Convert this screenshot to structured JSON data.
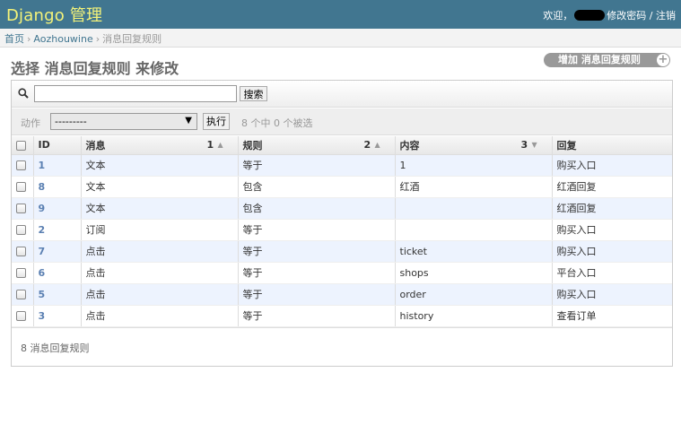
{
  "header": {
    "brand": "Django 管理",
    "welcome": "欢迎，",
    "change_password": "修改密码",
    "separator": "/",
    "logout": "注销"
  },
  "breadcrumbs": {
    "home": "首页",
    "app": "Aozhouwine",
    "current": "消息回复规则",
    "sep": "›"
  },
  "page_title": "选择 消息回复规则 来修改",
  "add_button": {
    "label": "增加 消息回复规则",
    "icon": "plus-icon"
  },
  "search": {
    "value": "",
    "placeholder": "",
    "button_label": "搜索",
    "icon": "search-icon"
  },
  "actions": {
    "label": "动作",
    "selected": "---------",
    "go_label": "执行",
    "counter": "8 个中 0 个被选"
  },
  "table": {
    "columns": [
      {
        "label": "ID"
      },
      {
        "label": "消息",
        "sort_priority": "1",
        "sort_dir": "asc"
      },
      {
        "label": "规则",
        "sort_priority": "2",
        "sort_dir": "asc"
      },
      {
        "label": "内容",
        "sort_priority": "3",
        "sort_dir": "desc"
      },
      {
        "label": "回复"
      }
    ],
    "rows": [
      {
        "id": "1",
        "msg": "文本",
        "rule": "等于",
        "content": "1",
        "reply": "购买入口"
      },
      {
        "id": "8",
        "msg": "文本",
        "rule": "包含",
        "content": "红酒",
        "reply": "红酒回复"
      },
      {
        "id": "9",
        "msg": "文本",
        "rule": "包含",
        "content": "",
        "reply": "红酒回复"
      },
      {
        "id": "2",
        "msg": "订阅",
        "rule": "等于",
        "content": "",
        "reply": "购买入口"
      },
      {
        "id": "7",
        "msg": "点击",
        "rule": "等于",
        "content": "ticket",
        "reply": "购买入口"
      },
      {
        "id": "6",
        "msg": "点击",
        "rule": "等于",
        "content": "shops",
        "reply": "平台入口"
      },
      {
        "id": "5",
        "msg": "点击",
        "rule": "等于",
        "content": "order",
        "reply": "购买入口"
      },
      {
        "id": "3",
        "msg": "点击",
        "rule": "等于",
        "content": "history",
        "reply": "查看订单"
      }
    ]
  },
  "paginator": "8 消息回复规则",
  "colors": {
    "header_bg": "#417690",
    "brand": "#f4f379",
    "link": "#5b80b2",
    "row_alt": "#edf3fe"
  }
}
